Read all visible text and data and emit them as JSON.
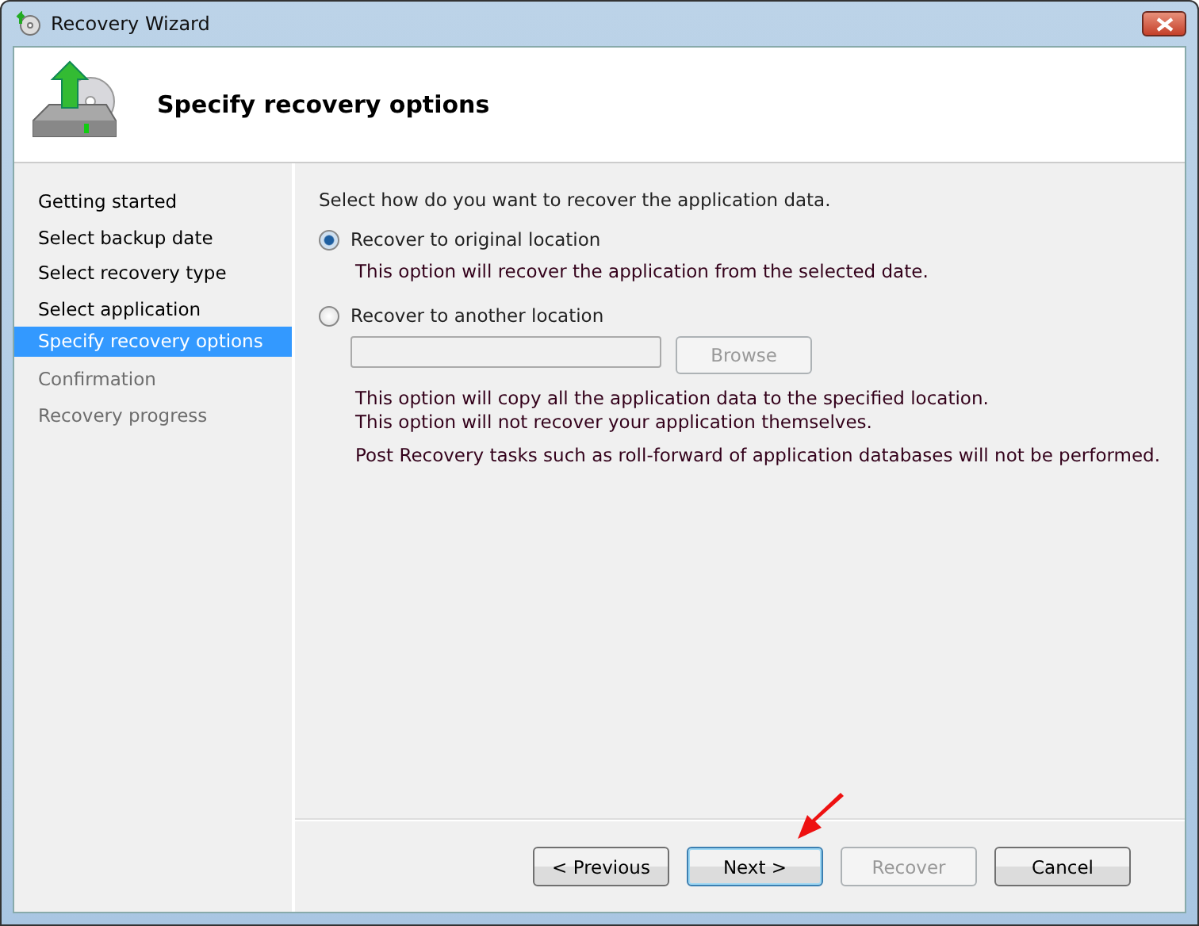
{
  "window": {
    "title": "Recovery Wizard"
  },
  "header": {
    "title": "Specify recovery options"
  },
  "steps": [
    {
      "label": "Getting started",
      "selected": false,
      "disabled": false
    },
    {
      "label": "Select backup date",
      "selected": false,
      "disabled": false
    },
    {
      "label": "Select recovery type",
      "selected": false,
      "disabled": false
    },
    {
      "label": "Select application",
      "selected": false,
      "disabled": false
    },
    {
      "label": "Specify recovery options",
      "selected": true,
      "disabled": false
    },
    {
      "label": "Confirmation",
      "selected": false,
      "disabled": true
    },
    {
      "label": "Recovery progress",
      "selected": false,
      "disabled": true
    }
  ],
  "prompt": "Select how do you want to recover the application data.",
  "options": [
    {
      "label": "Recover to original location",
      "selected": true,
      "notes": [
        "This option will recover the application from the selected date."
      ]
    },
    {
      "label": "Recover to another location",
      "selected": false,
      "location_field": {
        "disabled": true
      },
      "browse": {
        "label": "Browse",
        "disabled": true
      },
      "notes": [
        "This option will copy all the application data to the specified location.",
        "This option will not recover your application themselves.",
        "Post Recovery tasks such as roll-forward of application databases will not be performed."
      ]
    }
  ],
  "buttons": [
    {
      "label": "< Previous",
      "disabled": false,
      "focused": false
    },
    {
      "label": "Next >",
      "disabled": false,
      "focused": true
    },
    {
      "label": "Recover",
      "disabled": true,
      "focused": false
    },
    {
      "label": "Cancel",
      "disabled": false,
      "focused": false
    }
  ]
}
